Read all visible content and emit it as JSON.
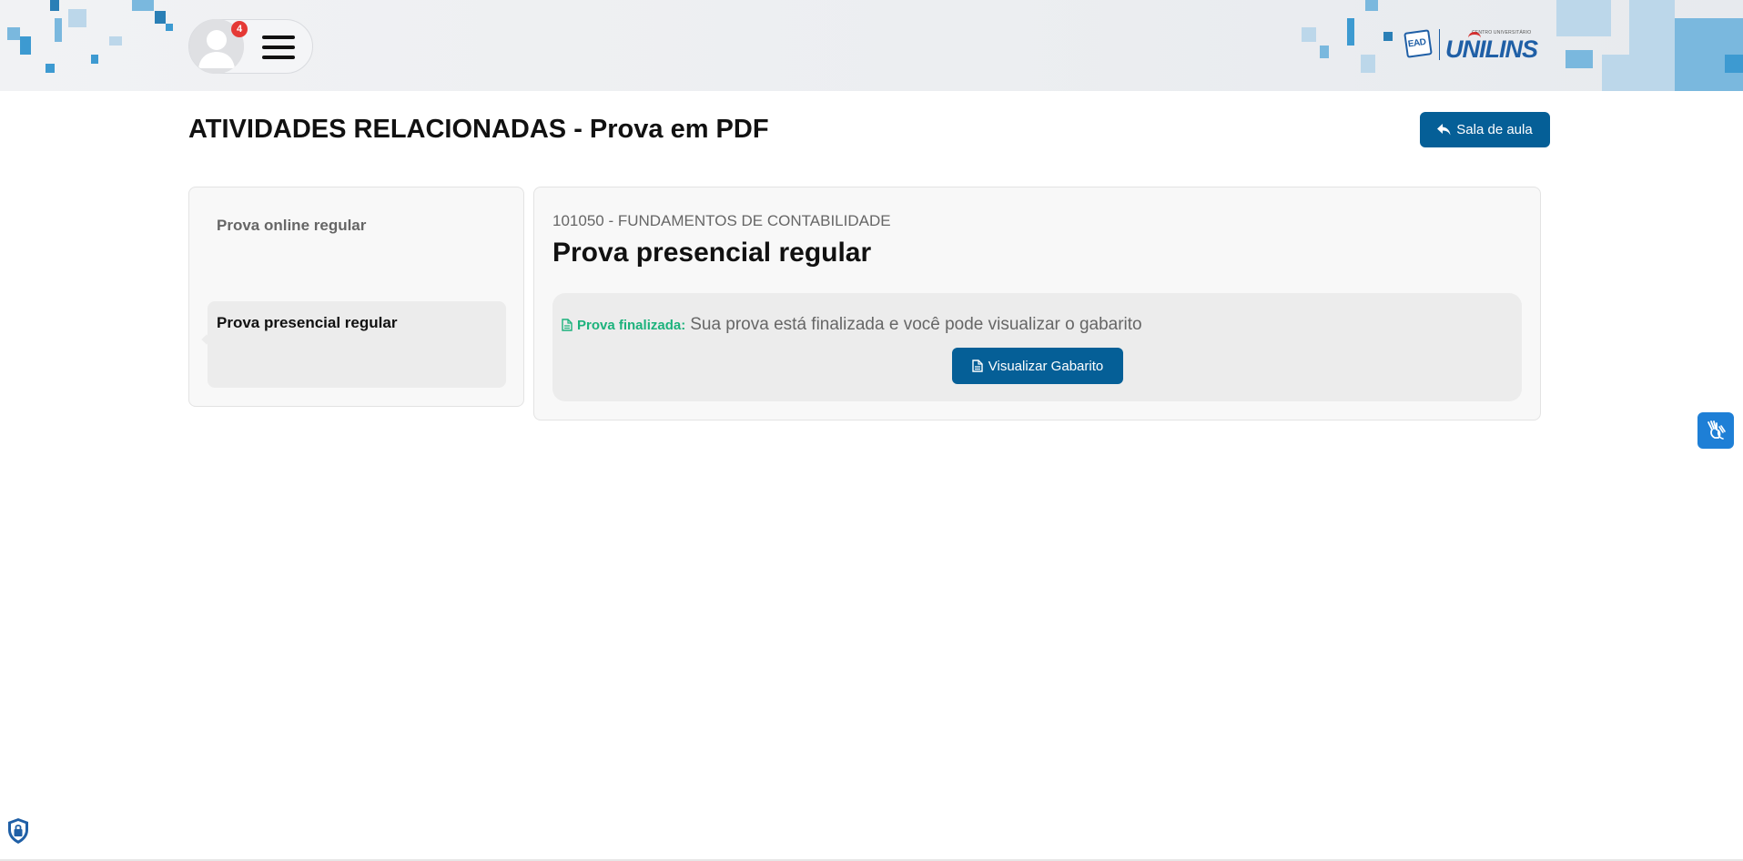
{
  "header": {
    "notification_count": "4",
    "avatar_icon": "user-avatar-icon",
    "menu_icon": "hamburger-menu-icon",
    "logo": {
      "ead_text": "EAD",
      "small_text": "CENTRO UNIVERSITÁRIO",
      "main_text": "UNILINS"
    }
  },
  "page": {
    "title": "ATIVIDADES RELACIONADAS - Prova em PDF",
    "back_button_label": "Sala de aula",
    "back_button_icon": "reply-arrow-icon"
  },
  "sidebar": {
    "items": [
      {
        "label": "Prova online regular",
        "active": false
      },
      {
        "label": "Prova presencial regular",
        "active": true
      }
    ]
  },
  "main": {
    "course_code": "101050 - FUNDAMENTOS DE CONTABILIDADE",
    "exam_title": "Prova presencial regular",
    "status": {
      "label": "Prova finalizada:",
      "text": "Sua prova está finalizada e você pode visualizar o gabarito",
      "icon": "document-icon"
    },
    "gabarito_button_label": "Visualizar Gabarito"
  },
  "widgets": {
    "libras_icon": "sign-language-hands-icon",
    "privacy_icon": "privacy-shield-lock-icon"
  },
  "colors": {
    "primary": "#055f97",
    "success": "#1cb27c",
    "badge": "#e53935",
    "libras": "#1e7fd6"
  }
}
